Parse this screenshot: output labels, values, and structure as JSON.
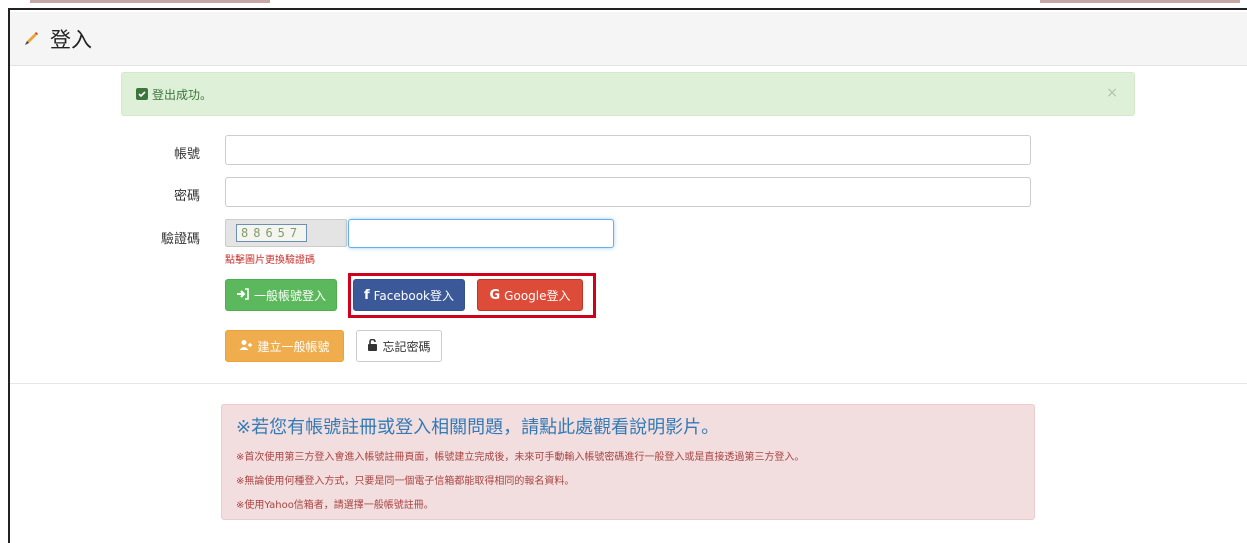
{
  "page": {
    "title": "登入"
  },
  "alert_success": {
    "message": "登出成功。",
    "close": "×"
  },
  "form": {
    "account_label": "帳號",
    "password_label": "密碼",
    "captcha_label": "驗證碼",
    "captcha_code": "88657",
    "captcha_hint": "點擊圖片更換驗證碼"
  },
  "buttons": {
    "general_login": "一般帳號登入",
    "facebook_login": "Facebook登入",
    "google_login": "Google登入",
    "create_account": "建立一般帳號",
    "forgot_password": "忘記密碼"
  },
  "notice": {
    "headline": "※若您有帳號註冊或登入相關問題，請點此處觀看說明影片。",
    "lines": [
      "※首次使用第三方登入會進入帳號註冊頁面，帳號建立完成後，未來可手動輸入帳號密碼進行一般登入或是直接透過第三方登入。",
      "※無論使用何種登入方式，只要是同一個電子信箱都能取得相同的報名資料。",
      "※使用Yahoo信箱者，請選擇一般帳號註冊。"
    ]
  },
  "colors": {
    "success_bg": "#dff0d8",
    "danger_bg": "#f2dede",
    "green": "#5cb85c",
    "facebook": "#3b5998",
    "google": "#dd4b39",
    "orange": "#f0ad4e",
    "highlight": "#d0021b"
  }
}
